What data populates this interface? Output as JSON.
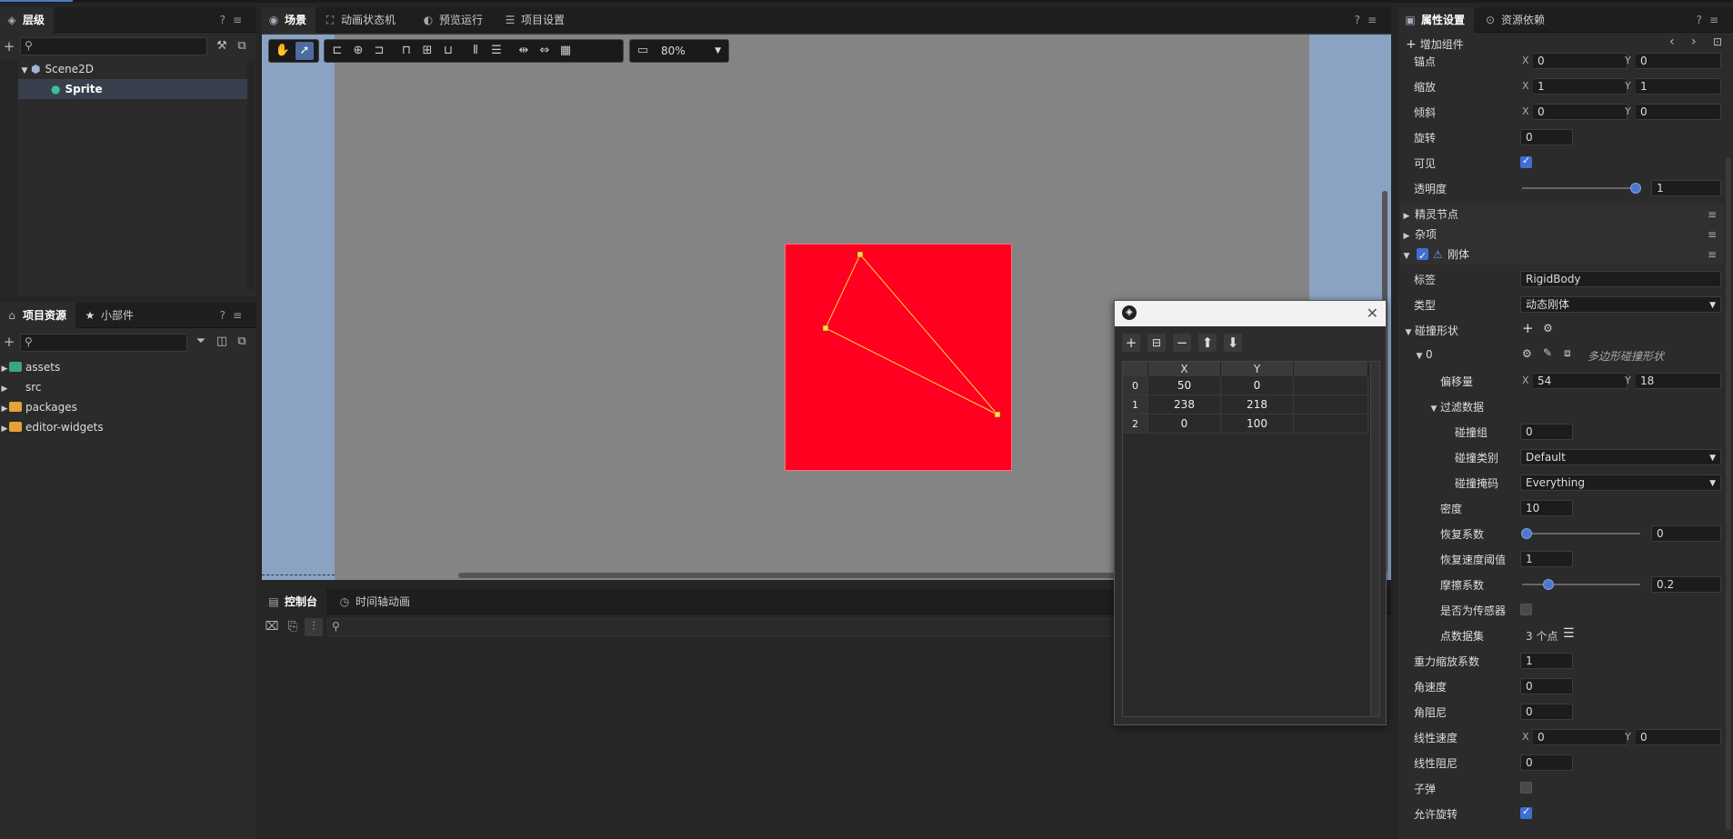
{
  "hierarchy": {
    "tab": "层级",
    "search_placeholder": "",
    "nodes": [
      {
        "label": "Scene2D"
      },
      {
        "label": "Sprite"
      }
    ]
  },
  "assets": {
    "tabs": [
      "项目资源",
      "小部件"
    ],
    "items": [
      {
        "label": "assets",
        "color": "#3aa776"
      },
      {
        "label": "src",
        "color": "#2b2b2b"
      },
      {
        "label": "packages",
        "color": "#e5a13a"
      },
      {
        "label": "editor-widgets",
        "color": "#e5a13a"
      }
    ]
  },
  "center": {
    "tabs": [
      "场景",
      "动画状态机",
      "预览运行",
      "项目设置"
    ],
    "zoom": "80%",
    "bottom_tabs": [
      "控制台",
      "时间轴动画"
    ]
  },
  "colors": {
    "sprite": "#ff0020",
    "accent": "#4e6aa0",
    "stage": "#848484",
    "scene_bg": "#8aa3c3"
  },
  "dialog": {
    "columns": [
      "X",
      "Y"
    ],
    "rows": [
      {
        "idx": "0",
        "x": "50",
        "y": "0"
      },
      {
        "idx": "1",
        "x": "238",
        "y": "218"
      },
      {
        "idx": "2",
        "x": "0",
        "y": "100"
      }
    ]
  },
  "inspector": {
    "tabs": [
      "属性设置",
      "资源依赖"
    ],
    "add_component": "增加组件",
    "anchor": {
      "label": "锚点",
      "x": "0",
      "y": "0"
    },
    "scale": {
      "label": "缩放",
      "x": "1",
      "y": "1"
    },
    "skew": {
      "label": "倾斜",
      "x": "0",
      "y": "0"
    },
    "rotation": {
      "label": "旋转",
      "value": "0"
    },
    "visible": {
      "label": "可见",
      "checked": true
    },
    "alpha": {
      "label": "透明度",
      "value": "1",
      "fraction": 1.0
    },
    "sections": {
      "sprite_node": "精灵节点",
      "misc": "杂项",
      "rigidbody": "刚体"
    },
    "tag": {
      "label": "标签",
      "value": "RigidBody"
    },
    "type": {
      "label": "类型",
      "value": "动态刚体"
    },
    "shapes": {
      "label": "碰撞形状",
      "index": "0",
      "shape_name": "多边形碰撞形状"
    },
    "offset": {
      "label": "偏移量",
      "x": "54",
      "y": "18"
    },
    "filter": {
      "label": "过滤数据"
    },
    "group": {
      "label": "碰撞组",
      "value": "0"
    },
    "category": {
      "label": "碰撞类别",
      "value": "Default"
    },
    "mask": {
      "label": "碰撞掩码",
      "value": "Everything"
    },
    "density": {
      "label": "密度",
      "value": "10"
    },
    "restitution": {
      "label": "恢复系数",
      "value": "0",
      "fraction": 0.0
    },
    "restitution_threshold": {
      "label": "恢复速度阈值",
      "value": "1"
    },
    "friction": {
      "label": "摩擦系数",
      "value": "0.2",
      "fraction": 0.2
    },
    "sensor": {
      "label": "是否为传感器",
      "checked": false
    },
    "points": {
      "label": "点数据集",
      "value": "3 个点"
    },
    "gravity_scale": {
      "label": "重力缩放系数",
      "value": "1"
    },
    "angular_velocity": {
      "label": "角速度",
      "value": "0"
    },
    "angular_damping": {
      "label": "角阻尼",
      "value": "0"
    },
    "linear_velocity": {
      "label": "线性速度",
      "x": "0",
      "y": "0"
    },
    "linear_damping": {
      "label": "线性阻尼",
      "value": "0"
    },
    "bullet": {
      "label": "子弹",
      "checked": false
    },
    "allow_rotation": {
      "label": "允许旋转",
      "checked": true
    }
  }
}
